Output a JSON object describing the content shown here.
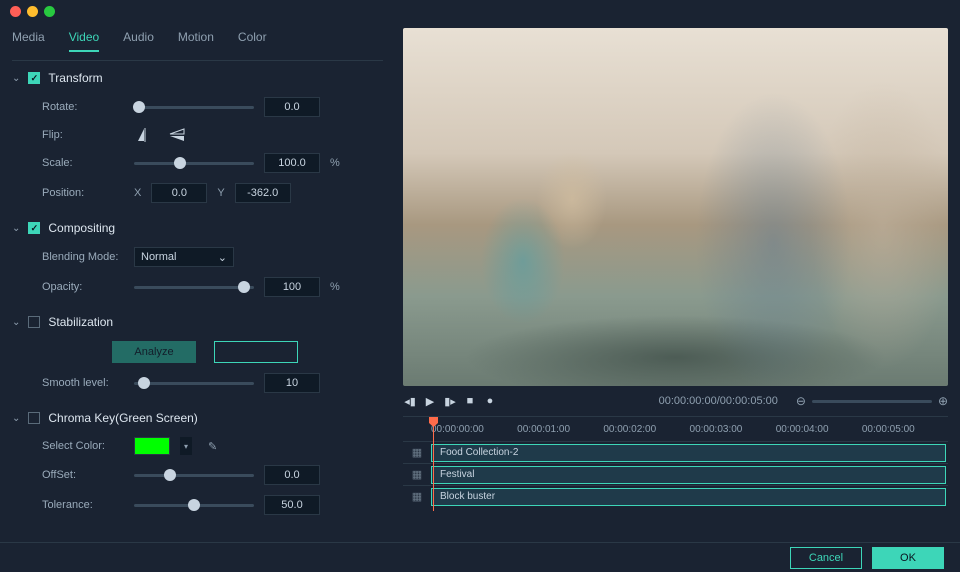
{
  "tabs": [
    "Media",
    "Video",
    "Audio",
    "Motion",
    "Color"
  ],
  "active_tab_index": 1,
  "transform": {
    "title": "Transform",
    "checked": true,
    "rotate": {
      "label": "Rotate:",
      "value": "0.0",
      "pct": 4
    },
    "flip": {
      "label": "Flip:"
    },
    "scale": {
      "label": "Scale:",
      "value": "100.0",
      "unit": "%",
      "pct": 38
    },
    "position": {
      "label": "Position:",
      "x": "0.0",
      "y": "-362.0"
    }
  },
  "compositing": {
    "title": "Compositing",
    "checked": true,
    "blend": {
      "label": "Blending Mode:",
      "value": "Normal"
    },
    "opacity": {
      "label": "Opacity:",
      "value": "100",
      "unit": "%",
      "pct": 92
    }
  },
  "stabilization": {
    "title": "Stabilization",
    "checked": false,
    "analyze_label": "Analyze",
    "smooth": {
      "label": "Smooth level:",
      "value": "10",
      "pct": 8
    }
  },
  "chroma": {
    "title": "Chroma Key(Green Screen)",
    "checked": false,
    "select": {
      "label": "Select Color:",
      "swatch": "#00ff00"
    },
    "offset": {
      "label": "OffSet:",
      "value": "0.0",
      "pct": 30
    },
    "tolerance": {
      "label": "Tolerance:",
      "value": "50.0",
      "pct": 50
    }
  },
  "playback": {
    "timecode": "00:00:00:00/00:00:05:00"
  },
  "ruler": [
    "00:00:00:00",
    "00:00:01:00",
    "00:00:02:00",
    "00:00:03:00",
    "00:00:04:00",
    "00:00:05:00"
  ],
  "tracks": [
    {
      "label": "Food Collection-2"
    },
    {
      "label": "Festival"
    },
    {
      "label": "Block buster"
    }
  ],
  "footer": {
    "cancel": "Cancel",
    "ok": "OK"
  }
}
